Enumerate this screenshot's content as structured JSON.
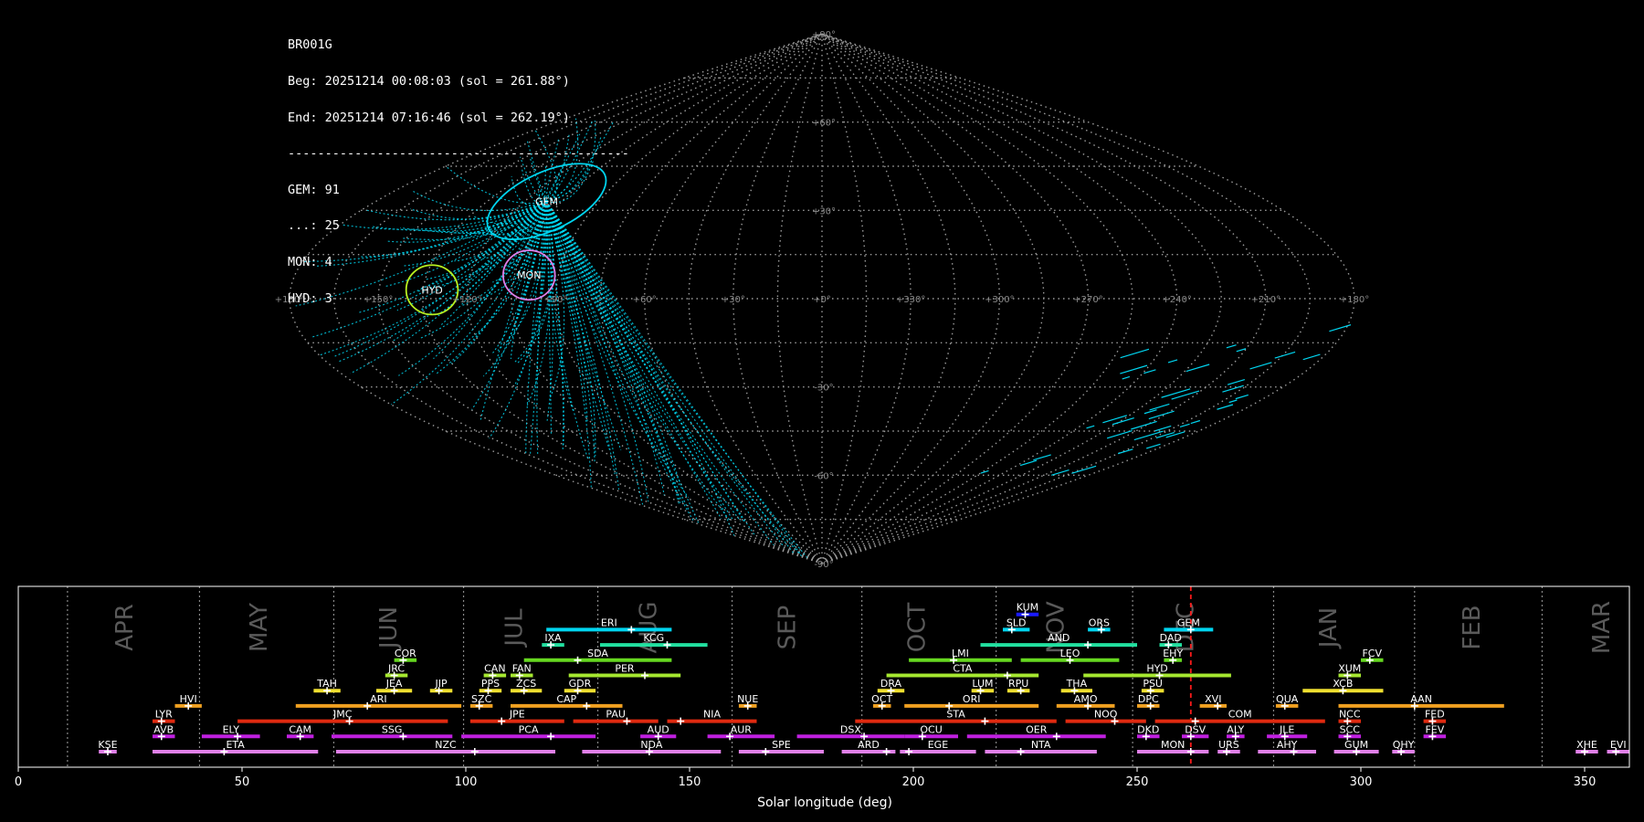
{
  "info": {
    "station": "BR001G",
    "begin": "Beg: 20251214 00:08:03 (sol = 261.88°)",
    "end": "End: 20251214 07:16:46 (sol = 262.19°)",
    "separator": "----------------------------------------------",
    "counts": [
      {
        "label": "GEM: 91"
      },
      {
        "label": "...: 25"
      },
      {
        "label": "MON: 4"
      },
      {
        "label": "HYD: 3"
      }
    ]
  },
  "sky_map": {
    "lon_labels": [
      {
        "lon": 180,
        "text": "+180°"
      },
      {
        "lon": 150,
        "text": "+150°"
      },
      {
        "lon": 120,
        "text": "+120°"
      },
      {
        "lon": 90,
        "text": "+90°"
      },
      {
        "lon": 60,
        "text": "+60°"
      },
      {
        "lon": 30,
        "text": "+30°"
      },
      {
        "lon": 0,
        "text": "+0°"
      },
      {
        "lon": -30,
        "text": "+330°"
      },
      {
        "lon": -60,
        "text": "+300°"
      },
      {
        "lon": -90,
        "text": "+270°"
      },
      {
        "lon": -120,
        "text": "+240°"
      },
      {
        "lon": -150,
        "text": "+210°"
      },
      {
        "lon": -180,
        "text": "+180°"
      }
    ],
    "lat_labels": [
      {
        "lat": 90,
        "text": "+90°"
      },
      {
        "lat": 60,
        "text": "+60°"
      },
      {
        "lat": 30,
        "text": "+30°"
      },
      {
        "lat": -30,
        "text": "-30°"
      },
      {
        "lat": -60,
        "text": "-60°"
      },
      {
        "lat": -90,
        "text": "-90°"
      }
    ],
    "showers": [
      {
        "code": "GEM",
        "lon": 111,
        "lat": 33,
        "color": "#00d5f0",
        "radius_deg": 11
      },
      {
        "code": "MON",
        "lon": 100,
        "lat": 8,
        "color": "#e07ee8",
        "radius_deg": 8
      },
      {
        "code": "HYD",
        "lon": 132,
        "lat": 3,
        "color": "#b8f020",
        "radius_deg": 8
      }
    ],
    "track_color": "#00d5f0"
  },
  "chart_data": {
    "type": "timeline",
    "xlabel": "Solar longitude (deg)",
    "xlim": [
      0,
      360
    ],
    "xticks": [
      0,
      50,
      100,
      150,
      200,
      250,
      300,
      350
    ],
    "current_sol": 262.0,
    "months": [
      {
        "name": "APR",
        "boundary": 11,
        "center": 24
      },
      {
        "name": "MAY",
        "boundary": 40.5,
        "center": 54
      },
      {
        "name": "JUN",
        "boundary": 70.5,
        "center": 83
      },
      {
        "name": "JUL",
        "boundary": 99.5,
        "center": 111
      },
      {
        "name": "AUG",
        "boundary": 129.5,
        "center": 141
      },
      {
        "name": "SEP",
        "boundary": 159.5,
        "center": 172
      },
      {
        "name": "OCT",
        "boundary": 188.5,
        "center": 201
      },
      {
        "name": "NOV",
        "boundary": 218.5,
        "center": 232
      },
      {
        "name": "DEC",
        "boundary": 249,
        "center": 261
      },
      {
        "name": "JAN",
        "boundary": 280.5,
        "center": 293
      },
      {
        "name": "FEB",
        "boundary": 312,
        "center": 325
      },
      {
        "name": "MAR",
        "boundary": 340.5,
        "center": 354
      }
    ],
    "showers": [
      {
        "code": "KUM",
        "row": 10,
        "start": 223,
        "end": 228,
        "peak": 225,
        "color": "#1a1aff"
      },
      {
        "code": "ERI",
        "row": 9,
        "start": 118,
        "end": 146,
        "peak": 137,
        "color": "#00d5f0"
      },
      {
        "code": "SLD",
        "row": 9,
        "start": 220,
        "end": 226,
        "peak": 222,
        "color": "#00d5f0"
      },
      {
        "code": "ORS",
        "row": 9,
        "start": 239,
        "end": 244,
        "peak": 242,
        "color": "#00d5f0"
      },
      {
        "code": "GEM",
        "row": 9,
        "start": 256,
        "end": 267,
        "peak": 262,
        "color": "#00d5f0"
      },
      {
        "code": "IXA",
        "row": 8,
        "start": 117,
        "end": 122,
        "peak": 119,
        "color": "#22e0a0"
      },
      {
        "code": "KCG",
        "row": 8,
        "start": 130,
        "end": 154,
        "peak": 145,
        "color": "#22e0a0"
      },
      {
        "code": "AND",
        "row": 8,
        "start": 215,
        "end": 250,
        "peak": 239,
        "color": "#22e0a0"
      },
      {
        "code": "DAD",
        "row": 8,
        "start": 255,
        "end": 260,
        "peak": 257,
        "color": "#22e0a0"
      },
      {
        "code": "COR",
        "row": 7,
        "start": 84,
        "end": 89,
        "peak": 86,
        "color": "#66d820"
      },
      {
        "code": "SDA",
        "row": 7,
        "start": 113,
        "end": 146,
        "peak": 125,
        "color": "#66d820"
      },
      {
        "code": "LMI",
        "row": 7,
        "start": 199,
        "end": 222,
        "peak": 209,
        "color": "#66d820"
      },
      {
        "code": "LEO",
        "row": 7,
        "start": 224,
        "end": 246,
        "peak": 235,
        "color": "#66d820"
      },
      {
        "code": "EHY",
        "row": 7,
        "start": 256,
        "end": 260,
        "peak": 258,
        "color": "#66d820"
      },
      {
        "code": "FCV",
        "row": 7,
        "start": 300,
        "end": 305,
        "peak": 302,
        "color": "#66d820"
      },
      {
        "code": "JRC",
        "row": 6,
        "start": 82,
        "end": 87,
        "peak": 84,
        "color": "#a6e830"
      },
      {
        "code": "CAN",
        "row": 6,
        "start": 104,
        "end": 109,
        "peak": 106,
        "color": "#a6e830"
      },
      {
        "code": "FAN",
        "row": 6,
        "start": 110,
        "end": 115,
        "peak": 112,
        "color": "#a6e830"
      },
      {
        "code": "PER",
        "row": 6,
        "start": 123,
        "end": 148,
        "peak": 140,
        "color": "#a6e830"
      },
      {
        "code": "CTA",
        "row": 6,
        "start": 194,
        "end": 228,
        "peak": 221,
        "color": "#a6e830"
      },
      {
        "code": "HYD",
        "row": 6,
        "start": 238,
        "end": 271,
        "peak": 255,
        "color": "#a6e830"
      },
      {
        "code": "XUM",
        "row": 6,
        "start": 295,
        "end": 300,
        "peak": 297,
        "color": "#a6e830"
      },
      {
        "code": "TAH",
        "row": 5,
        "start": 66,
        "end": 72,
        "peak": 69,
        "color": "#f0e030"
      },
      {
        "code": "JEA",
        "row": 5,
        "start": 80,
        "end": 88,
        "peak": 84,
        "color": "#f0e030"
      },
      {
        "code": "JIP",
        "row": 5,
        "start": 92,
        "end": 97,
        "peak": 94,
        "color": "#f0e030"
      },
      {
        "code": "PPS",
        "row": 5,
        "start": 103,
        "end": 108,
        "peak": 105,
        "color": "#f0e030"
      },
      {
        "code": "ZCS",
        "row": 5,
        "start": 110,
        "end": 117,
        "peak": 113,
        "color": "#f0e030"
      },
      {
        "code": "GDR",
        "row": 5,
        "start": 122,
        "end": 129,
        "peak": 125,
        "color": "#f0e030"
      },
      {
        "code": "DRA",
        "row": 5,
        "start": 192,
        "end": 198,
        "peak": 195,
        "color": "#f0e030"
      },
      {
        "code": "LUM",
        "row": 5,
        "start": 213,
        "end": 218,
        "peak": 215,
        "color": "#f0e030"
      },
      {
        "code": "RPU",
        "row": 5,
        "start": 221,
        "end": 226,
        "peak": 224,
        "color": "#f0e030"
      },
      {
        "code": "THA",
        "row": 5,
        "start": 233,
        "end": 240,
        "peak": 236,
        "color": "#f0e030"
      },
      {
        "code": "PSU",
        "row": 5,
        "start": 251,
        "end": 256,
        "peak": 253,
        "color": "#f0e030"
      },
      {
        "code": "XCB",
        "row": 5,
        "start": 287,
        "end": 305,
        "peak": 296,
        "color": "#f0e030"
      },
      {
        "code": "HVI",
        "row": 4,
        "start": 35,
        "end": 41,
        "peak": 38,
        "color": "#f0a020"
      },
      {
        "code": "ARI",
        "row": 4,
        "start": 62,
        "end": 99,
        "peak": 78,
        "color": "#f0a020"
      },
      {
        "code": "SZC",
        "row": 4,
        "start": 101,
        "end": 106,
        "peak": 103,
        "color": "#f0a020"
      },
      {
        "code": "CAP",
        "row": 4,
        "start": 110,
        "end": 135,
        "peak": 127,
        "color": "#f0a020"
      },
      {
        "code": "NUE",
        "row": 4,
        "start": 161,
        "end": 165,
        "peak": 163,
        "color": "#f0a020"
      },
      {
        "code": "OCT",
        "row": 4,
        "start": 191,
        "end": 195,
        "peak": 193,
        "color": "#f0a020"
      },
      {
        "code": "ORI",
        "row": 4,
        "start": 198,
        "end": 228,
        "peak": 208,
        "color": "#f0a020"
      },
      {
        "code": "AMO",
        "row": 4,
        "start": 232,
        "end": 245,
        "peak": 239,
        "color": "#f0a020"
      },
      {
        "code": "DPC",
        "row": 4,
        "start": 250,
        "end": 255,
        "peak": 253,
        "color": "#f0a020"
      },
      {
        "code": "XVI",
        "row": 4,
        "start": 264,
        "end": 270,
        "peak": 268,
        "color": "#f0a020"
      },
      {
        "code": "QUA",
        "row": 4,
        "start": 281,
        "end": 286,
        "peak": 283,
        "color": "#f0a020"
      },
      {
        "code": "AAN",
        "row": 4,
        "start": 295,
        "end": 332,
        "peak": 312,
        "color": "#f0a020"
      },
      {
        "code": "LYR",
        "row": 3,
        "start": 30,
        "end": 35,
        "peak": 32,
        "color": "#e02a10"
      },
      {
        "code": "JMC",
        "row": 3,
        "start": 49,
        "end": 96,
        "peak": 74,
        "color": "#e02a10"
      },
      {
        "code": "JPE",
        "row": 3,
        "start": 101,
        "end": 122,
        "peak": 108,
        "color": "#e02a10"
      },
      {
        "code": "PAU",
        "row": 3,
        "start": 124,
        "end": 143,
        "peak": 136,
        "color": "#e02a10"
      },
      {
        "code": "NIA",
        "row": 3,
        "start": 145,
        "end": 165,
        "peak": 148,
        "color": "#e02a10"
      },
      {
        "code": "STA",
        "row": 3,
        "start": 187,
        "end": 232,
        "peak": 216,
        "color": "#e02a10"
      },
      {
        "code": "NOO",
        "row": 3,
        "start": 234,
        "end": 252,
        "peak": 245,
        "color": "#e02a10"
      },
      {
        "code": "COM",
        "row": 3,
        "start": 254,
        "end": 292,
        "peak": 263,
        "color": "#e02a10"
      },
      {
        "code": "NCC",
        "row": 3,
        "start": 295,
        "end": 300,
        "peak": 297,
        "color": "#e02a10"
      },
      {
        "code": "FED",
        "row": 3,
        "start": 314,
        "end": 319,
        "peak": 316,
        "color": "#e02a10"
      },
      {
        "code": "AVB",
        "row": 2,
        "start": 30,
        "end": 35,
        "peak": 32,
        "color": "#c020e0"
      },
      {
        "code": "ELY",
        "row": 2,
        "start": 41,
        "end": 54,
        "peak": 49,
        "color": "#c020e0"
      },
      {
        "code": "CAM",
        "row": 2,
        "start": 60,
        "end": 66,
        "peak": 63,
        "color": "#c020e0"
      },
      {
        "code": "SSG",
        "row": 2,
        "start": 70,
        "end": 97,
        "peak": 86,
        "color": "#c020e0"
      },
      {
        "code": "PCA",
        "row": 2,
        "start": 99,
        "end": 129,
        "peak": 119,
        "color": "#c020e0"
      },
      {
        "code": "AUD",
        "row": 2,
        "start": 139,
        "end": 147,
        "peak": 143,
        "color": "#c020e0"
      },
      {
        "code": "AUR",
        "row": 2,
        "start": 154,
        "end": 169,
        "peak": 159,
        "color": "#c020e0"
      },
      {
        "code": "DSX",
        "row": 2,
        "start": 174,
        "end": 198,
        "peak": 189,
        "color": "#c020e0"
      },
      {
        "code": "OCU",
        "row": 2,
        "start": 198,
        "end": 210,
        "peak": 202,
        "color": "#c020e0"
      },
      {
        "code": "OER",
        "row": 2,
        "start": 212,
        "end": 243,
        "peak": 232,
        "color": "#c020e0"
      },
      {
        "code": "DKD",
        "row": 2,
        "start": 250,
        "end": 255,
        "peak": 252,
        "color": "#c020e0"
      },
      {
        "code": "DSV",
        "row": 2,
        "start": 260,
        "end": 266,
        "peak": 262,
        "color": "#c020e0"
      },
      {
        "code": "ALY",
        "row": 2,
        "start": 270,
        "end": 274,
        "peak": 272,
        "color": "#c020e0"
      },
      {
        "code": "JLE",
        "row": 2,
        "start": 279,
        "end": 288,
        "peak": 283,
        "color": "#c020e0"
      },
      {
        "code": "SCC",
        "row": 2,
        "start": 295,
        "end": 300,
        "peak": 297,
        "color": "#c020e0"
      },
      {
        "code": "FEV",
        "row": 2,
        "start": 314,
        "end": 319,
        "peak": 316,
        "color": "#c020e0"
      },
      {
        "code": "KSE",
        "row": 1,
        "start": 18,
        "end": 22,
        "peak": 20,
        "color": "#e080e8"
      },
      {
        "code": "ETA",
        "row": 1,
        "start": 30,
        "end": 67,
        "peak": 46,
        "color": "#e080e8"
      },
      {
        "code": "NZC",
        "row": 1,
        "start": 71,
        "end": 120,
        "peak": 102,
        "color": "#e080e8"
      },
      {
        "code": "NDA",
        "row": 1,
        "start": 126,
        "end": 157,
        "peak": 141,
        "color": "#e080e8"
      },
      {
        "code": "SPE",
        "row": 1,
        "start": 161,
        "end": 180,
        "peak": 167,
        "color": "#e080e8"
      },
      {
        "code": "ARD",
        "row": 1,
        "start": 184,
        "end": 196,
        "peak": 194,
        "color": "#e080e8"
      },
      {
        "code": "EGE",
        "row": 1,
        "start": 197,
        "end": 214,
        "peak": 199,
        "color": "#e080e8"
      },
      {
        "code": "NTA",
        "row": 1,
        "start": 216,
        "end": 241,
        "peak": 224,
        "color": "#e080e8"
      },
      {
        "code": "MON",
        "row": 1,
        "start": 250,
        "end": 266,
        "peak": 262,
        "color": "#e080e8"
      },
      {
        "code": "URS",
        "row": 1,
        "start": 268,
        "end": 273,
        "peak": 270,
        "color": "#e080e8"
      },
      {
        "code": "AHY",
        "row": 1,
        "start": 277,
        "end": 290,
        "peak": 285,
        "color": "#e080e8"
      },
      {
        "code": "GUM",
        "row": 1,
        "start": 294,
        "end": 304,
        "peak": 299,
        "color": "#e080e8"
      },
      {
        "code": "QHY",
        "row": 1,
        "start": 307,
        "end": 312,
        "peak": 309,
        "color": "#e080e8"
      },
      {
        "code": "XHE",
        "row": 1,
        "start": 348,
        "end": 353,
        "peak": 350,
        "color": "#e080e8"
      },
      {
        "code": "EVI",
        "row": 1,
        "start": 355,
        "end": 360,
        "peak": 357,
        "color": "#e080e8"
      }
    ]
  }
}
